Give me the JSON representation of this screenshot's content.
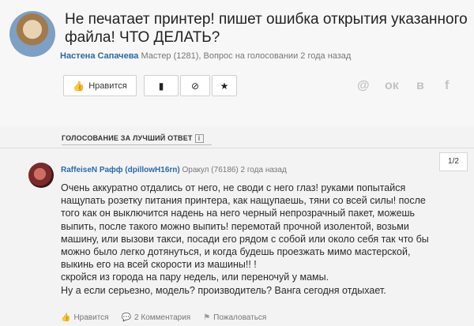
{
  "question": {
    "title": "Не печатает принтер! пишет ошибка открытия указанного файла! ЧТО ДЕЛАТЬ?",
    "author": "Настена Сапачева",
    "meta_rest": "Мастер (1281), Вопрос на голосовании 2 года назад"
  },
  "toolbar": {
    "like_label": "Нравится",
    "like_icon": "thumbs-up-icon",
    "bookmark_icon": "bookmark-icon",
    "block_icon": "block-icon",
    "star_icon": "star-icon"
  },
  "share": {
    "at": "@",
    "ok": "ок",
    "vk": "в",
    "fb": "f"
  },
  "vote_section": {
    "title": "ГОЛОСОВАНИЕ ЗА ЛУЧШИЙ ОТВЕТ",
    "info": "i"
  },
  "answer": {
    "author": "RaffeiseN Рафф (dpillowH16rn)",
    "meta_rest": "Оракул (76186) 2 года назад",
    "pager": "1/2",
    "lines": [
      "Очень аккуратно отдались от него, не своди с него глаз! руками попытайся",
      "нащупать розетку питания принтера, как нащупаешь, тяни со всей силы! после",
      "того как он выключится надень на него черный непрозрачный пакет, можешь",
      "выпить, после такого можно выпить! перемотай прочной изолентой, возьми",
      "машину, или вызови такси, посади его рядом с собой или около себя так что бы",
      "можно было легко дотянуться, и когда будешь проезжать мимо мастерской,",
      "выкинь его на всей скорости из машины!! !",
      "скройся из города на пару недель, или переночуй у мамы.",
      "Ну а если серьезно, модель? производитель? Ванга сегодня отдыхает."
    ],
    "actions": {
      "like": "Нравится",
      "comments": "2 Комментария",
      "report": "Пожаловаться"
    }
  }
}
